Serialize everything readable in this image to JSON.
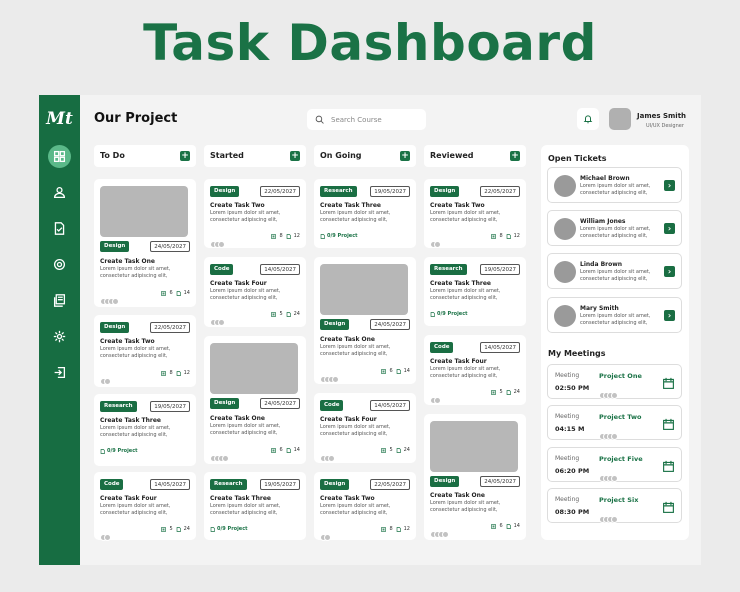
{
  "hero_title": "Task Dashboard",
  "app": {
    "logo": "Mt",
    "page_title": "Our Project",
    "search_placeholder": "Search Course",
    "user": {
      "name": "James Smith",
      "role": "UI/UX Designer"
    }
  },
  "nav_icons": [
    "dashboard-icon",
    "user-icon",
    "document-check-icon",
    "settings-icon",
    "library-icon",
    "gear-icon",
    "logout-icon"
  ],
  "columns": {
    "todo": {
      "title": "To Do",
      "cards": [
        {
          "tag": "Design",
          "date": "24/05/2027",
          "title": "Create Task One",
          "desc": "Lorem ipsum dolor sit amet, consectetur adipiscing elit,",
          "files": "6",
          "docs": "14"
        },
        {
          "tag": "Design",
          "date": "22/05/2027",
          "title": "Create Task Two",
          "desc": "Lorem ipsum dolor sit amet, consectetur adipiscing elit,",
          "files": "8",
          "docs": "12"
        },
        {
          "tag": "Research",
          "date": "19/05/2027",
          "title": "Create Task Three",
          "desc": "Lorem ipsum dolor sit amet, consectetur adipiscing elit,",
          "project": "0/9 Project"
        },
        {
          "tag": "Code",
          "date": "14/05/2027",
          "title": "Create Task Four",
          "desc": "Lorem ipsum dolor sit amet, consectetur adipiscing elit,",
          "files": "5",
          "docs": "24"
        }
      ]
    },
    "started": {
      "title": "Started",
      "cards": [
        {
          "tag": "Design",
          "date": "22/05/2027",
          "title": "Create Task Two",
          "desc": "Lorem ipsum dolor sit amet, consectetur adipiscing elit,",
          "files": "8",
          "docs": "12"
        },
        {
          "tag": "Code",
          "date": "14/05/2027",
          "title": "Create Task Four",
          "desc": "Lorem ipsum dolor sit amet, consectetur adipiscing elit,",
          "files": "5",
          "docs": "24"
        },
        {
          "tag": "Design",
          "date": "24/05/2027",
          "title": "Create Task One",
          "desc": "Lorem ipsum dolor sit amet, consectetur adipiscing elit,",
          "files": "6",
          "docs": "14"
        },
        {
          "tag": "Research",
          "date": "19/05/2027",
          "title": "Create Task Three",
          "desc": "Lorem ipsum dolor sit amet, consectetur adipiscing elit,",
          "project": "0/9 Project"
        }
      ]
    },
    "ongoing": {
      "title": "On Going",
      "cards": [
        {
          "tag": "Research",
          "date": "19/05/2027",
          "title": "Create Task Three",
          "desc": "Lorem ipsum dolor sit amet, consectetur adipiscing elit,",
          "project": "0/9 Project"
        },
        {
          "tag": "Design",
          "date": "24/05/2027",
          "title": "Create Task One",
          "desc": "Lorem ipsum dolor sit amet, consectetur adipiscing elit,",
          "files": "6",
          "docs": "14"
        },
        {
          "tag": "Code",
          "date": "14/05/2027",
          "title": "Create Task Four",
          "desc": "Lorem ipsum dolor sit amet, consectetur adipiscing elit,",
          "files": "5",
          "docs": "24"
        },
        {
          "tag": "Design",
          "date": "22/05/2027",
          "title": "Create Task Two",
          "desc": "Lorem ipsum dolor sit amet, consectetur adipiscing elit,",
          "files": "8",
          "docs": "12"
        }
      ]
    },
    "reviewed": {
      "title": "Reviewed",
      "cards": [
        {
          "tag": "Design",
          "date": "22/05/2027",
          "title": "Create Task Two",
          "desc": "Lorem ipsum dolor sit amet, consectetur adipiscing elit,",
          "files": "8",
          "docs": "12"
        },
        {
          "tag": "Research",
          "date": "19/05/2027",
          "title": "Create Task Three",
          "desc": "Lorem ipsum dolor sit amet, consectetur adipiscing elit,",
          "project": "0/9 Project"
        },
        {
          "tag": "Code",
          "date": "14/05/2027",
          "title": "Create Task Four",
          "desc": "Lorem ipsum dolor sit amet, consectetur adipiscing elit,",
          "files": "5",
          "docs": "24"
        },
        {
          "tag": "Design",
          "date": "24/05/2027",
          "title": "Create Task One",
          "desc": "Lorem ipsum dolor sit amet, consectetur adipiscing elit,",
          "files": "6",
          "docs": "14"
        }
      ]
    }
  },
  "tickets": {
    "title": "Open Tickets",
    "items": [
      {
        "name": "Michael Brown",
        "desc": "Lorem ipsum dolor sit amet, consectetur adipiscing elit,"
      },
      {
        "name": "William Jones",
        "desc": "Lorem ipsum dolor sit amet, consectetur adipiscing elit,"
      },
      {
        "name": "Linda Brown",
        "desc": "Lorem ipsum dolor sit amet, consectetur adipiscing elit,"
      },
      {
        "name": "Mary Smith",
        "desc": "Lorem ipsum dolor sit amet, consectetur adipiscing elit,"
      }
    ]
  },
  "meetings": {
    "title": "My Meetings",
    "items": [
      {
        "label": "Meeting",
        "time": "02:50 PM",
        "project": "Project One"
      },
      {
        "label": "Meeting",
        "time": "04:15 M",
        "project": "Project Two"
      },
      {
        "label": "Meeting",
        "time": "06:20 PM",
        "project": "Project Five"
      },
      {
        "label": "Meeting",
        "time": "08:30 PM",
        "project": "Project Six"
      }
    ]
  },
  "colors": {
    "brand": "#176d42",
    "accent": "#5bb989"
  }
}
